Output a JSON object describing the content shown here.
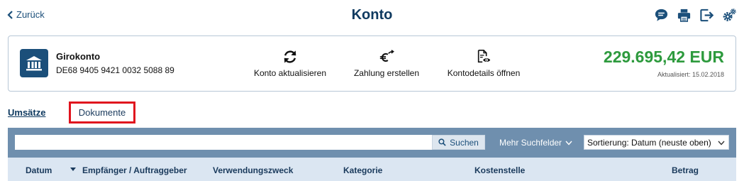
{
  "header": {
    "back_label": "Zurück",
    "title": "Konto",
    "icons": [
      "chat-icon",
      "print-icon",
      "logout-icon",
      "settings-icon"
    ]
  },
  "account": {
    "name": "Girokonto",
    "iban": "DE68 9405 9421 0032 5088 89",
    "balance": "229.695,42 EUR",
    "balance_color": "#2d9a3d",
    "updated": "Aktualisiert: 15.02.2018",
    "actions": [
      {
        "label": "Konto aktualisieren",
        "icon": "refresh-icon"
      },
      {
        "label": "Zahlung erstellen",
        "icon": "euro-transfer-icon"
      },
      {
        "label": "Kontodetails öffnen",
        "icon": "document-view-icon"
      }
    ]
  },
  "tabs": [
    {
      "label": "Umsätze",
      "active": true
    },
    {
      "label": "Dokumente",
      "active": false,
      "highlighted": true,
      "highlight_color": "#e0141e"
    }
  ],
  "search": {
    "value": "",
    "placeholder": "",
    "button_label": "Suchen",
    "more_fields_label": "Mehr Suchfelder",
    "sort_label": "Sortierung: Datum (neuste oben)"
  },
  "table": {
    "columns": [
      "Datum",
      "Empfänger / Auftraggeber",
      "Verwendungszweck",
      "Kategorie",
      "Kostenstelle",
      "Betrag"
    ]
  },
  "colors": {
    "primary": "#1b4f7a",
    "panel": "#6f8fae",
    "table_header": "#dbe6f2"
  }
}
